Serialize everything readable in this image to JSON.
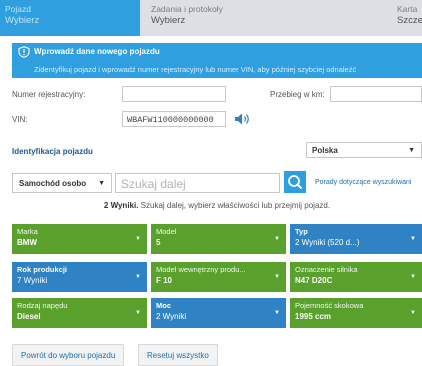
{
  "header": {
    "steps": [
      {
        "label": "Pojazd",
        "sub": "Wybierz"
      },
      {
        "label": "Zadania i protokoły",
        "sub": "Wybierz"
      },
      {
        "label": "Karta",
        "sub": "Szcze"
      }
    ]
  },
  "banner": {
    "title": "Wprowadź dane nowego pojazdu",
    "text": "Zidentyfikuj pojazd i wprowadź numer rejestracyjny lub numer VIN, aby później szybciej odnaleźć"
  },
  "form": {
    "reg_label": "Numer rejestracyjny:",
    "reg_value": "",
    "mileage_label": "Przebieg w km:",
    "mileage_value": "",
    "vin_label": "VIN:",
    "vin_value": "WBAFW110000000000"
  },
  "identification": {
    "title": "Identyfikacja pojazdu",
    "country": "Polska",
    "vehicle_type": "Samochód osobo",
    "search_placeholder": "Szukaj dalej",
    "search_help": "Porady dotyczące wyszukiwani",
    "results_count": "2 Wyniki.",
    "results_text": "Szukaj dalej, wybierz właściwości lub przejmij pojazd."
  },
  "tiles": [
    {
      "label": "Marka",
      "value": "BMW",
      "color": "green"
    },
    {
      "label": "Model",
      "value": "5",
      "color": "green"
    },
    {
      "label": "Typ",
      "value": "2 Wyniki (520 d...)",
      "color": "blue"
    },
    {
      "label": "Rok produkcji",
      "value": "7 Wyniki",
      "color": "blue"
    },
    {
      "label": "Model wewnętrzny produ...",
      "value": "F 10",
      "color": "green"
    },
    {
      "label": "Oznaczenie silnika",
      "value": "N47 D20C",
      "color": "green"
    },
    {
      "label": "Rodzaj napędu",
      "value": "Diesel",
      "color": "green"
    },
    {
      "label": "Moc",
      "value": "2 Wyniki",
      "color": "blue"
    },
    {
      "label": "Pojemność skokowa",
      "value": "1995 ccm",
      "color": "green"
    }
  ],
  "buttons": {
    "back": "Powrót do wyboru pojazdu",
    "reset": "Resetuj wszystko"
  },
  "colors": {
    "accent_blue": "#2f9fe0",
    "tile_green": "#5aa02c",
    "tile_blue": "#2f82c4",
    "link_blue": "#1e6fb0"
  }
}
